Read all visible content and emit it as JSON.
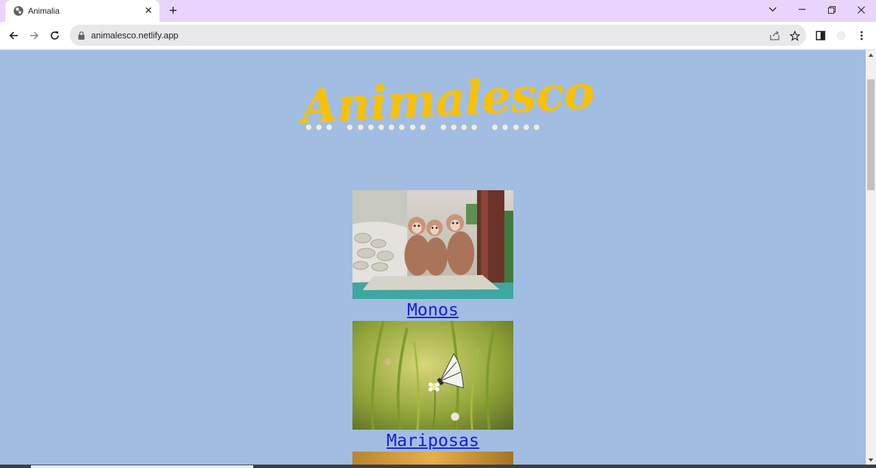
{
  "browser": {
    "tab_title": "Animalia",
    "url": "animalesco.netlify.app",
    "accent_color": "#e9d5fb"
  },
  "page": {
    "background_color": "#a1bde2",
    "logo": "Animalesco",
    "logo_color": "#f7c10a",
    "animals": [
      {
        "name": "Monos",
        "image": "monkeys-photo"
      },
      {
        "name": "Mariposas",
        "image": "butterfly-photo"
      },
      {
        "name": "",
        "image": "partially-visible-photo"
      }
    ],
    "link_color": "#1c1cd6"
  }
}
